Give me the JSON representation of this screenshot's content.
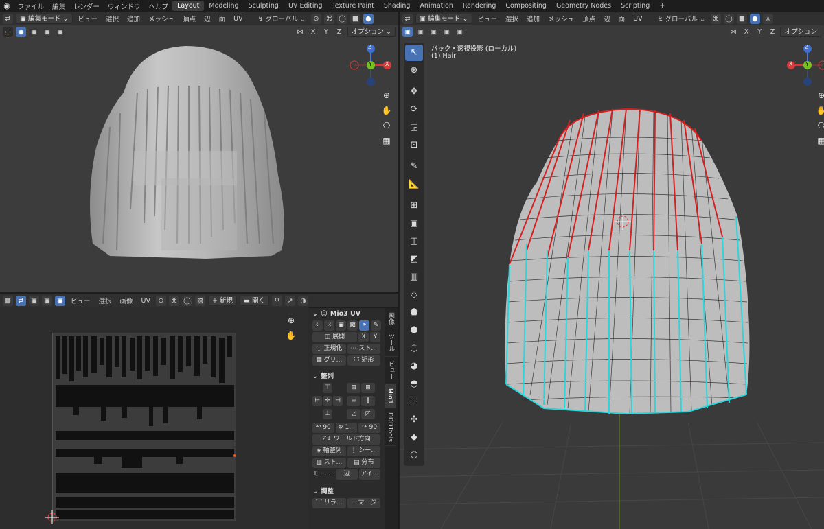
{
  "menu": {
    "items": [
      "ファイル",
      "編集",
      "レンダー",
      "ウィンドウ",
      "ヘルプ"
    ],
    "workspaces": [
      "Layout",
      "Modeling",
      "Sculpting",
      "UV Editing",
      "Texture Paint",
      "Shading",
      "Animation",
      "Rendering",
      "Compositing",
      "Geometry Nodes",
      "Scripting"
    ],
    "active_workspace": "Layout",
    "add_tab": "+"
  },
  "viewport_left": {
    "mode": "編集モード",
    "menus": [
      "ビュー",
      "選択",
      "追加",
      "メッシュ",
      "頂点",
      "辺",
      "面",
      "UV"
    ],
    "orientation": "グローバル",
    "axes": [
      "X",
      "Y",
      "Z"
    ],
    "options_label": "オプション"
  },
  "viewport_right": {
    "mode": "編集モード",
    "menus": [
      "ビュー",
      "選択",
      "追加",
      "メッシュ",
      "頂点",
      "辺",
      "面",
      "UV"
    ],
    "orientation": "グローバル",
    "axes": [
      "X",
      "Y",
      "Z"
    ],
    "options_label": "オプション",
    "view_name": "バック・透視投影 (ローカル)",
    "object_name": "(1) Hair"
  },
  "gizmo": {
    "z": "Z",
    "x": "X",
    "y": "Y"
  },
  "uv_editor": {
    "menus": [
      "ビュー",
      "選択",
      "画像",
      "UV"
    ],
    "new_label": "新規",
    "open_label": "開く",
    "new_icon": "+"
  },
  "sidebar": {
    "addon_title": "Mio3 UV",
    "unfold_label": "展開",
    "x_label": "X",
    "y_label": "Y",
    "normalize_label": "正規化",
    "straight_label": "スト...",
    "grid_label": "グリ...",
    "rect_label": "矩形",
    "align_header": "整列",
    "rotate_a": "90",
    "rotate_mid": "1...",
    "rotate_b": "90",
    "world_dir_label": "ワールド方向",
    "axis_align_label": "軸整列",
    "seam_label": "シー...",
    "straight2_label": "スト...",
    "distribute_label": "分布",
    "mode_label": "モー...",
    "edge_label": "辺",
    "island_label": "アイ...",
    "adjust_header": "調整",
    "relax_label": "リラ...",
    "merge_label": "マージ"
  },
  "vtabs": [
    "画像",
    "ツール",
    "ビュー",
    "Mio3",
    "DDDTools"
  ],
  "vtab_active": "Mio3",
  "colors": {
    "accent": "#4772b3",
    "seam": "#d42020",
    "boundary": "#2ad6dc",
    "mesh": "#bdbdbd"
  }
}
